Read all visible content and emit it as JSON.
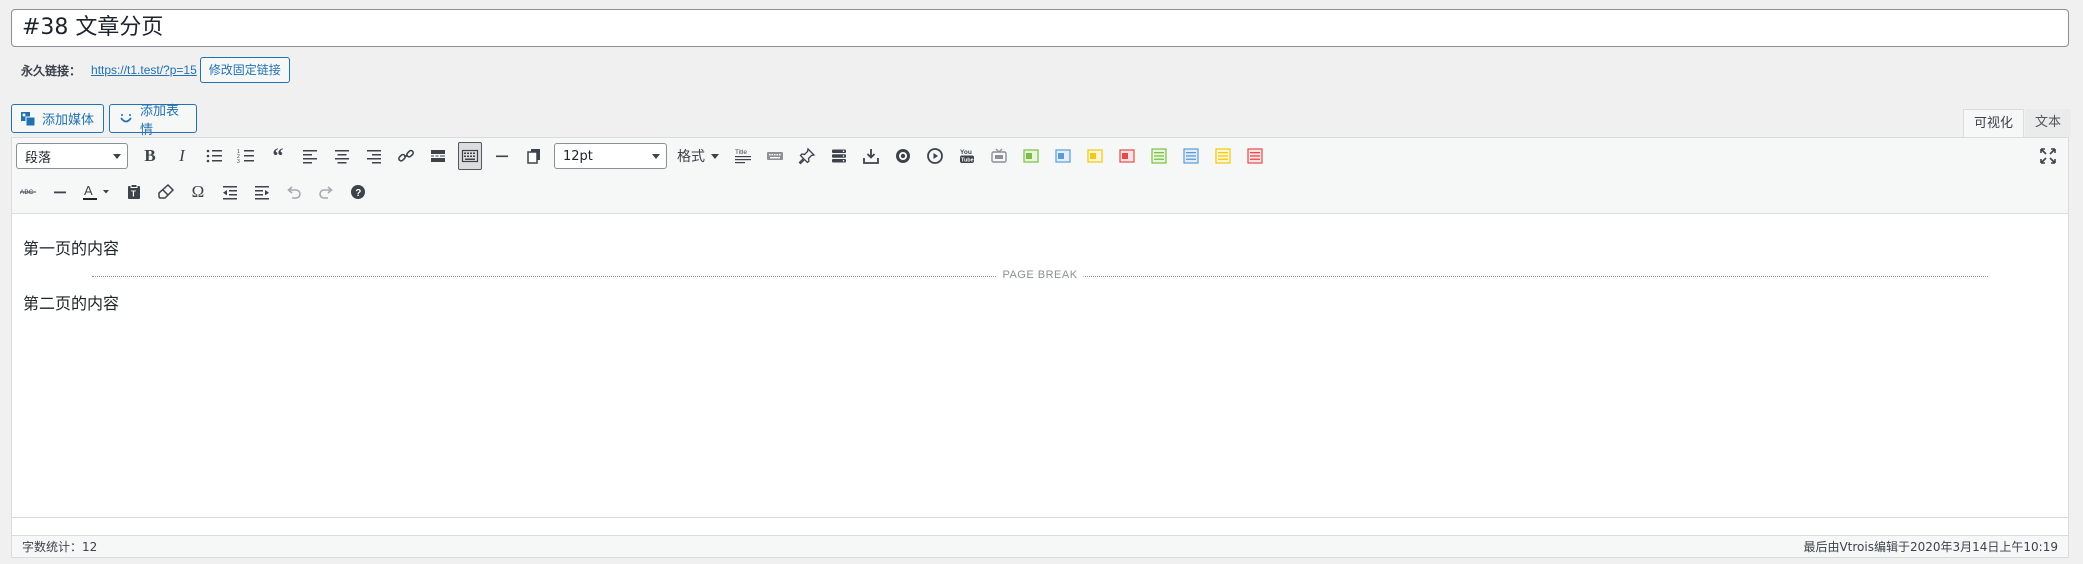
{
  "title": {
    "value": "#38 文章分页"
  },
  "permalink": {
    "label": "永久链接：",
    "url": "https://t1.test/?p=15",
    "edit_label": "修改固定链接"
  },
  "media_buttons": {
    "add_media": "添加媒体",
    "add_emoji": "添加表情"
  },
  "tabs": {
    "visual": "可视化",
    "text": "文本"
  },
  "toolbar": {
    "paragraph_select": "段落",
    "font_size_select": "12pt",
    "format_menu": "格式",
    "row1_icons": [
      "bold-icon",
      "italic-icon",
      "bulleted-list-icon",
      "numbered-list-icon",
      "blockquote-icon",
      "align-left-icon",
      "align-center-icon",
      "align-right-icon",
      "link-icon",
      "read-more-icon",
      "toolbar-toggle-icon",
      "horizontal-line-icon",
      "copy-icon"
    ],
    "row1_extra_icons": [
      "title-icon",
      "keyboard-icon",
      "pin-icon",
      "server-icon",
      "download-icon",
      "camera-icon",
      "play-icon",
      "youtube-icon",
      "tv-icon",
      "green-box-icon",
      "blue-box-icon",
      "yellow-box-icon",
      "red-box-icon",
      "green-list-icon",
      "blue-list-icon",
      "yellow-list-icon",
      "red-list-icon"
    ],
    "row2_icons": [
      "strikethrough-icon",
      "horizontal-rule-icon",
      "text-color-icon",
      "paste-as-text-icon",
      "clear-formatting-icon",
      "special-character-icon",
      "outdent-icon",
      "indent-icon",
      "undo-icon",
      "redo-icon",
      "help-icon"
    ]
  },
  "content": {
    "page1": "第一页的内容",
    "page_break_label": "PAGE BREAK",
    "page2": "第二页的内容"
  },
  "status": {
    "word_count": "字数统计：12",
    "last_edited": "最后由Vtrois编辑于2020年3月14日上午10:19"
  },
  "colors": {
    "accent": "#2271b1",
    "green": "#7ac143",
    "blue": "#5b9bd5",
    "yellow": "#f2c811",
    "red": "#e64b4b"
  }
}
